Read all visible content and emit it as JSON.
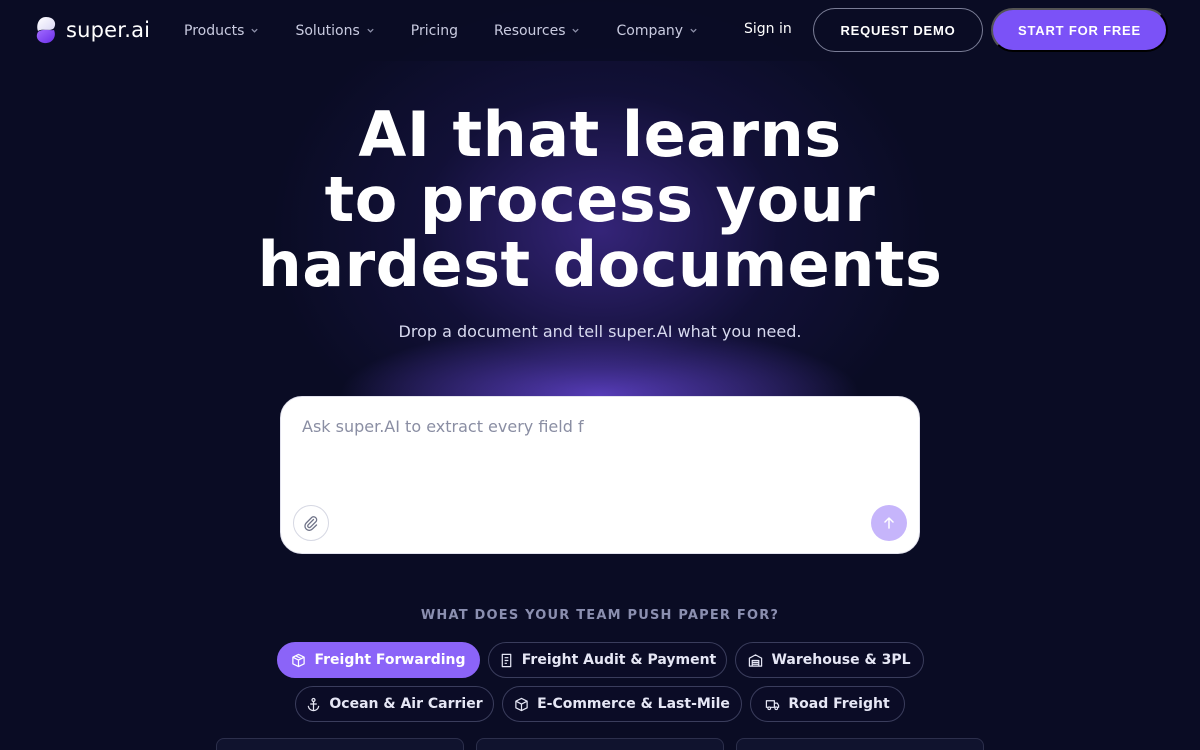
{
  "nav": {
    "logo_text": "super.ai",
    "items": [
      {
        "label": "Products",
        "has_dropdown": true
      },
      {
        "label": "Solutions",
        "has_dropdown": true
      },
      {
        "label": "Pricing",
        "has_dropdown": false
      },
      {
        "label": "Resources",
        "has_dropdown": true
      },
      {
        "label": "Company",
        "has_dropdown": true
      }
    ],
    "sign_in": "Sign in",
    "request_demo": "REQUEST DEMO",
    "start_free": "START FOR FREE"
  },
  "hero": {
    "title_lines": [
      "AI that learns",
      "to process your",
      "hardest documents"
    ],
    "subtitle": "Drop a document and tell super.AI what you need."
  },
  "prompt": {
    "value": "Ask super.AI to extract every field f",
    "attach_icon": "paperclip-icon",
    "send_icon": "arrow-up-icon"
  },
  "categories": {
    "heading": "WHAT DOES YOUR TEAM PUSH PAPER FOR?",
    "chips": [
      {
        "label": "Freight Forwarding",
        "icon": "package-icon",
        "active": true
      },
      {
        "label": "Freight Audit & Payment",
        "icon": "receipt-icon",
        "active": false
      },
      {
        "label": "Warehouse & 3PL",
        "icon": "warehouse-icon",
        "active": false
      },
      {
        "label": "Ocean & Air Carrier",
        "icon": "anchor-icon",
        "active": false
      },
      {
        "label": "E-Commerce & Last-Mile",
        "icon": "box-icon",
        "active": false
      },
      {
        "label": "Road Freight",
        "icon": "truck-icon",
        "active": false
      }
    ]
  },
  "colors": {
    "background": "#0a0c24",
    "accent": "#7b52f7",
    "active_chip": "#8b64f8",
    "send_button": "#c6b5fb"
  }
}
